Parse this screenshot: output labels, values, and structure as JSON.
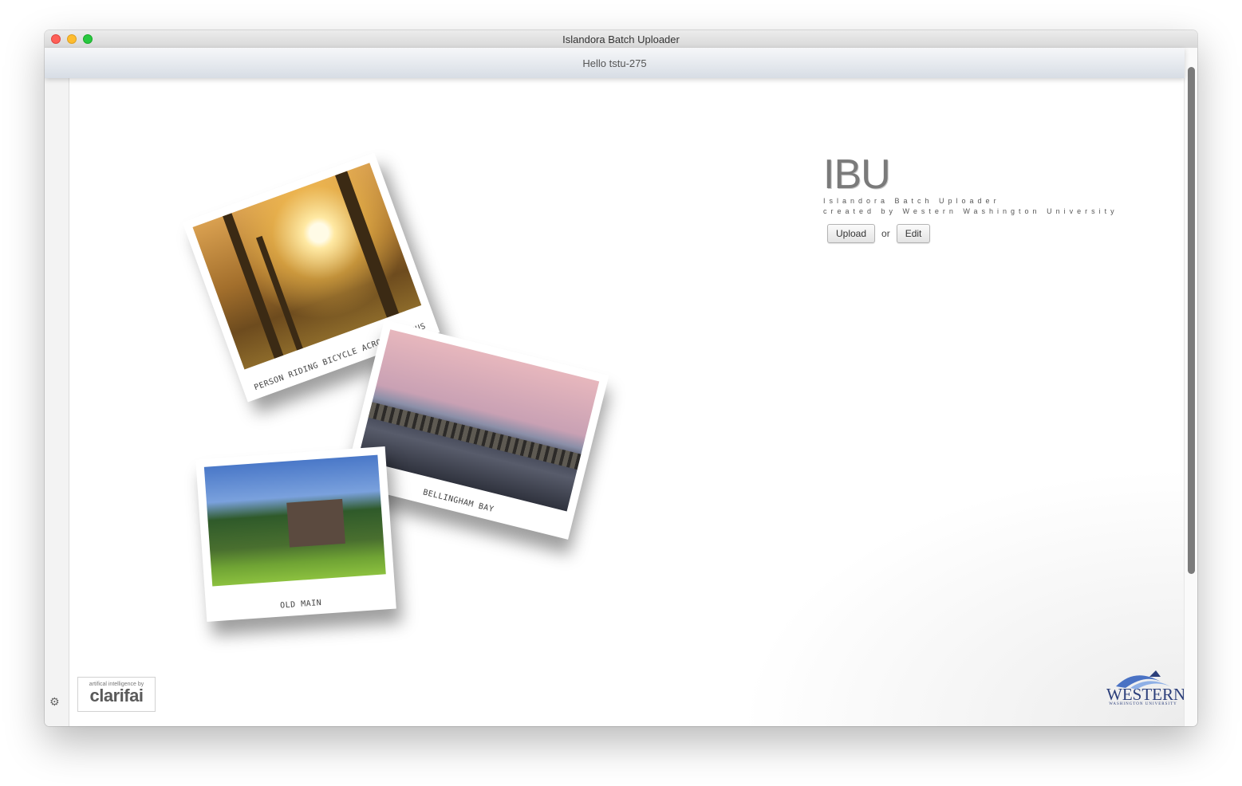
{
  "window": {
    "title": "Islandora Batch Uploader"
  },
  "header": {
    "greeting": "Hello tstu-275"
  },
  "hero": {
    "logo": "IBU",
    "subtitle_line1": "Islandora Batch Uploader",
    "subtitle_line2": "created by Western Washington University",
    "upload_label": "Upload",
    "or_text": "or",
    "edit_label": "Edit"
  },
  "photos": [
    {
      "caption": "Person riding bicycle across campus"
    },
    {
      "caption": "Bellingham Bay"
    },
    {
      "caption": "Old Main"
    }
  ],
  "branding": {
    "clarifai_prefix": "artifical intelligence by",
    "clarifai_name": "clarifai",
    "western_name": "WESTERN",
    "western_sub": "WASHINGTON UNIVERSITY"
  },
  "icons": {
    "settings": "gear-icon",
    "window_close": "close-icon",
    "window_minimize": "minimize-icon",
    "window_zoom": "zoom-icon"
  },
  "colors": {
    "close": "#fe5f57",
    "minimize": "#febc2e",
    "zoom": "#28c840",
    "western_blue": "#2b3e7a"
  }
}
